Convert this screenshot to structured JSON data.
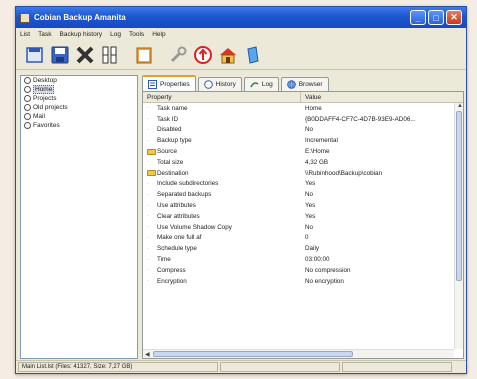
{
  "window": {
    "title": "Cobian Backup Amanita"
  },
  "menu": [
    "List",
    "Task",
    "Backup history",
    "Log",
    "Tools",
    "Help"
  ],
  "toolbar": {
    "icons": [
      "new-list-icon",
      "save-list-icon",
      "delete-icon",
      "properties-icon",
      "clipboard-icon",
      "tools-icon",
      "backup-now-icon",
      "home-icon",
      "help-book-icon"
    ]
  },
  "tasks": [
    "Desktop",
    "Home",
    "Projects",
    "Old projects",
    "Mail",
    "Favorites"
  ],
  "selected_task": "Home",
  "tabs": [
    {
      "label": "Properties",
      "active": true
    },
    {
      "label": "History",
      "active": false
    },
    {
      "label": "Log",
      "active": false
    },
    {
      "label": "Browser",
      "active": false
    }
  ],
  "grid": {
    "columns": [
      "Property",
      "Value"
    ],
    "rows": [
      {
        "property": "Task name",
        "value": "Home",
        "folder": false
      },
      {
        "property": "Task ID",
        "value": "{B0DDAFF4-CF7C-4D7B-93E9-AD06...",
        "folder": false
      },
      {
        "property": "Disabled",
        "value": "No",
        "folder": false
      },
      {
        "property": "Backup type",
        "value": "Incremental",
        "folder": false
      },
      {
        "property": "Source",
        "value": "E:\\Home",
        "folder": true
      },
      {
        "property": "Total size",
        "value": "4,32 GB",
        "folder": false
      },
      {
        "property": "Destination",
        "value": "\\\\Rubinhood\\Backup\\cobian",
        "folder": true
      },
      {
        "property": "Include subdirectories",
        "value": "Yes",
        "folder": false
      },
      {
        "property": "Separated backups",
        "value": "No",
        "folder": false
      },
      {
        "property": "Use attributes",
        "value": "Yes",
        "folder": false
      },
      {
        "property": "Clear attributes",
        "value": "Yes",
        "folder": false
      },
      {
        "property": "Use Volume Shadow Copy",
        "value": "No",
        "folder": false
      },
      {
        "property": "Make one full af",
        "value": "0",
        "folder": false
      },
      {
        "property": "Schedule type",
        "value": "Daily",
        "folder": false
      },
      {
        "property": "Time",
        "value": "03:00:00",
        "folder": false
      },
      {
        "property": "Compress",
        "value": "No compression",
        "folder": false
      },
      {
        "property": "Encryption",
        "value": "No encryption",
        "folder": false
      }
    ]
  },
  "status": {
    "text": "Main List.lst (Files: 41327, Size: 7,27 GB)"
  },
  "colors": {
    "titlebar": "#1c56d0",
    "active_tab_accent": "#e89c2c"
  }
}
